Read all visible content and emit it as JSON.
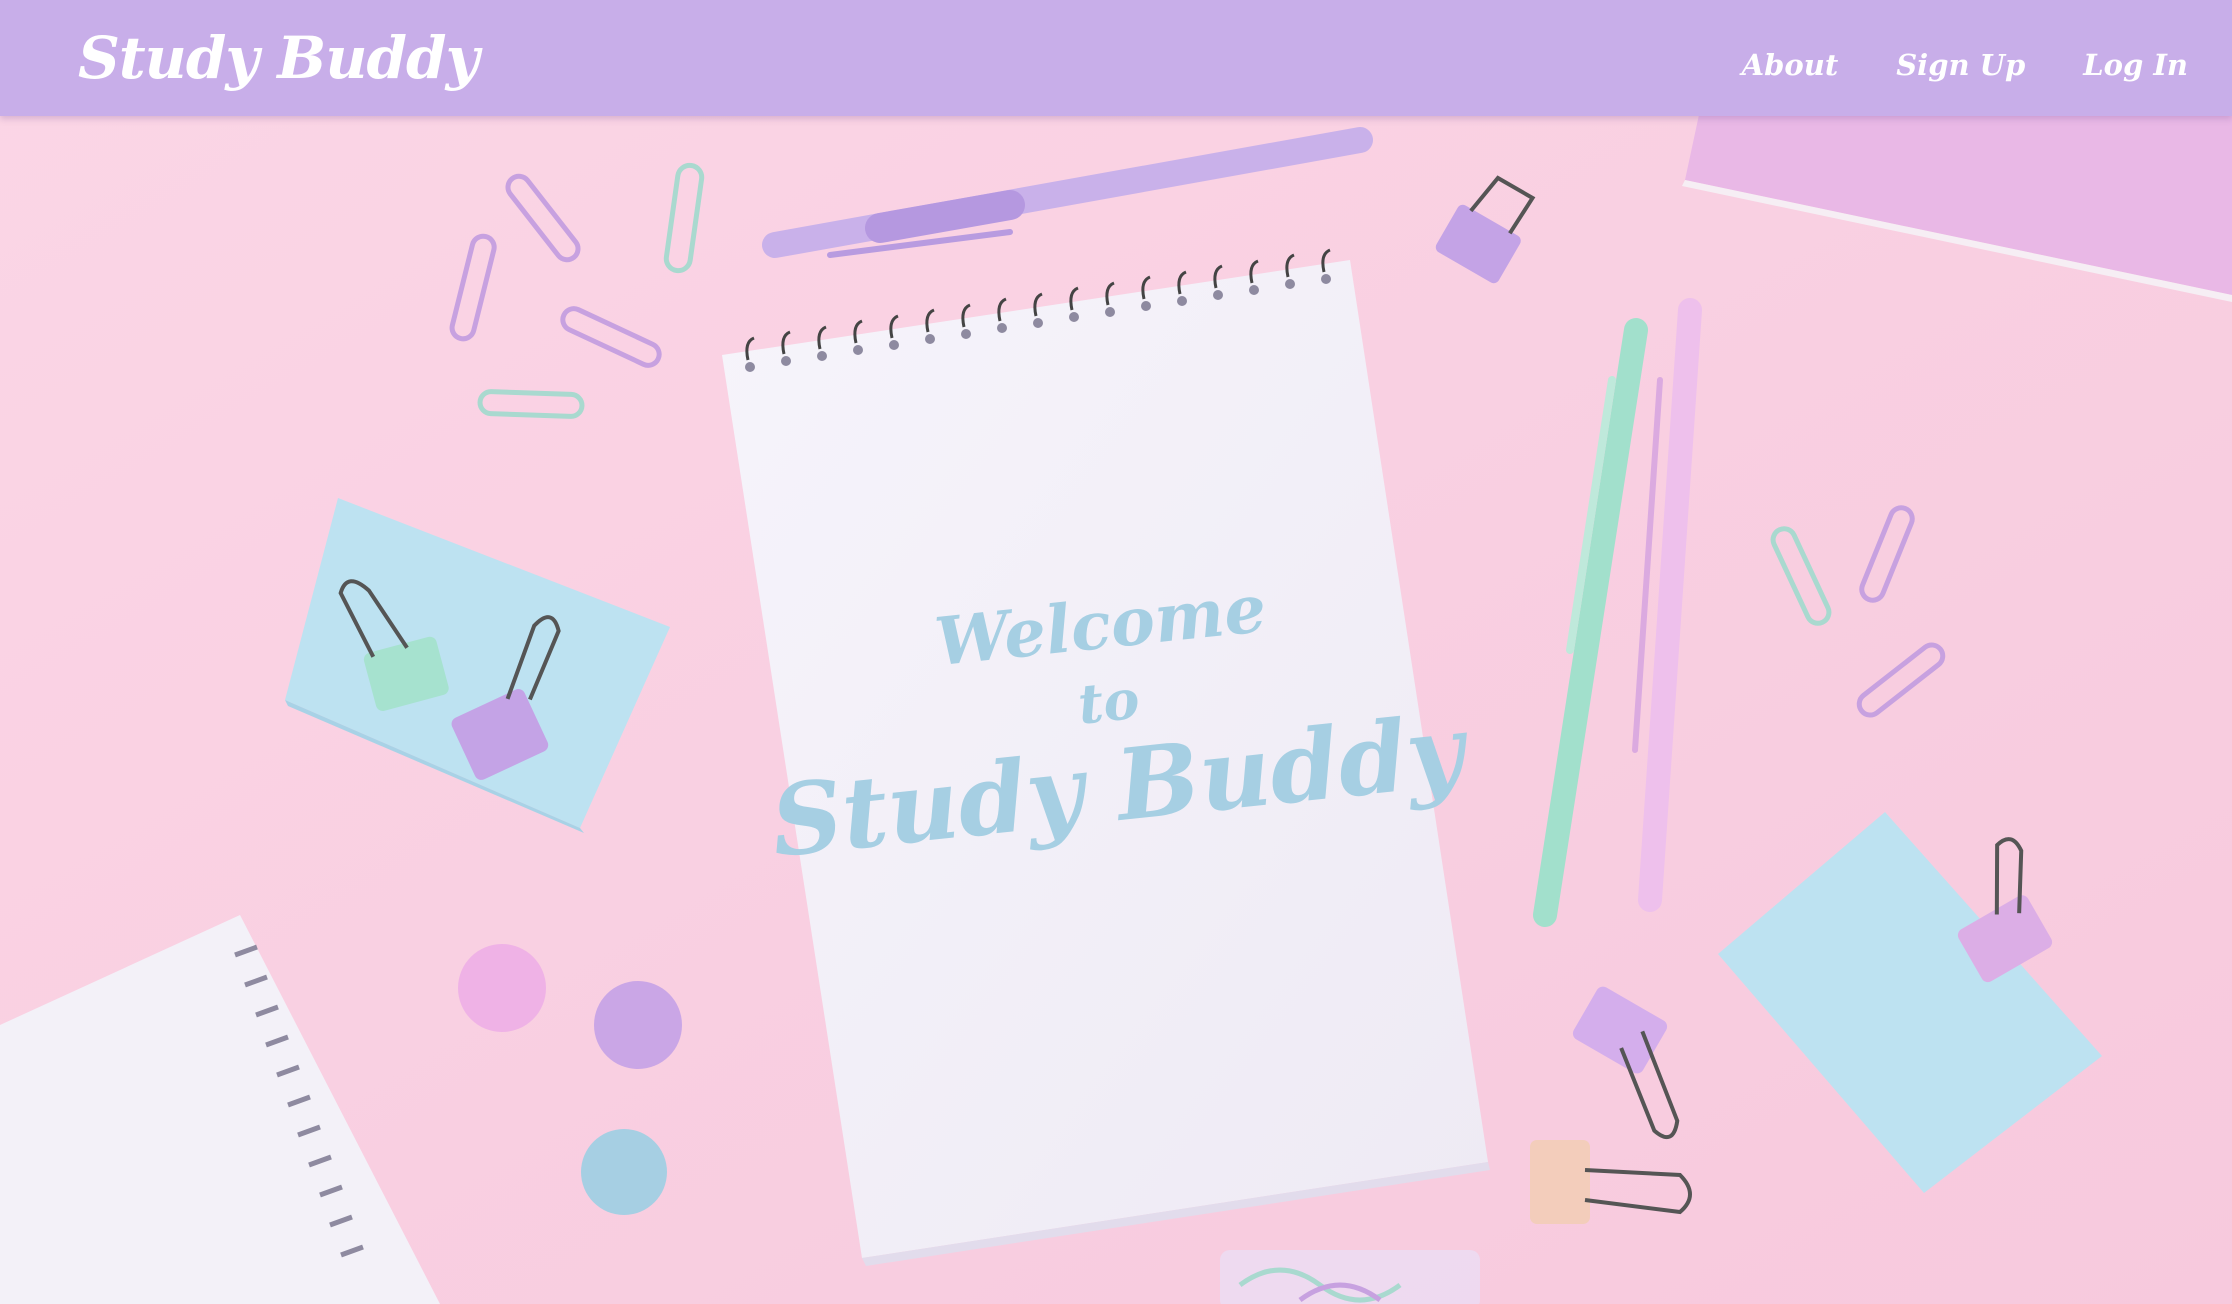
{
  "navbar": {
    "brand": "Study Buddy",
    "links": [
      "About",
      "Sign Up",
      "Log In"
    ]
  },
  "hero": {
    "line1": "Welcome",
    "line2": "to",
    "line3": "Study Buddy"
  },
  "colors": {
    "navbar": "#c8aee9",
    "background": "#f9cfe0",
    "welcome_text": "#a6cfe3",
    "nav_text": "#ffffff"
  }
}
